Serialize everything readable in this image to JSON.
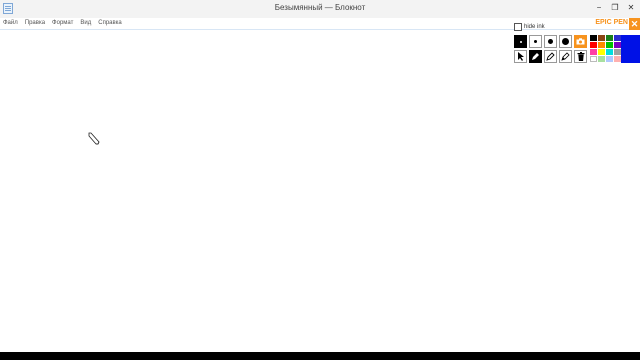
{
  "window": {
    "title": "Безымянный — Блокнот",
    "controls": {
      "minimize": "−",
      "restore": "❐",
      "close": "✕"
    }
  },
  "menu": [
    "Файл",
    "Правка",
    "Формат",
    "Вид",
    "Справка"
  ],
  "epic_pen": {
    "hide_ink_label": "hide ink",
    "brand": "EPIC PEN",
    "close_symbol": "✕",
    "accent_color": "#f7931e",
    "current_color": "#0011e6",
    "palette": [
      "#000000",
      "#8b4513",
      "#1a7f1a",
      "#2b2bcf",
      "#ff0000",
      "#ff8c00",
      "#00c000",
      "#7a00c0",
      "#ff3fa4",
      "#ffff00",
      "#00e0e0",
      "#a0a0a0",
      "#ffffff",
      "#a8e0a0",
      "#b0c8ff",
      "#ffb0b0"
    ]
  }
}
